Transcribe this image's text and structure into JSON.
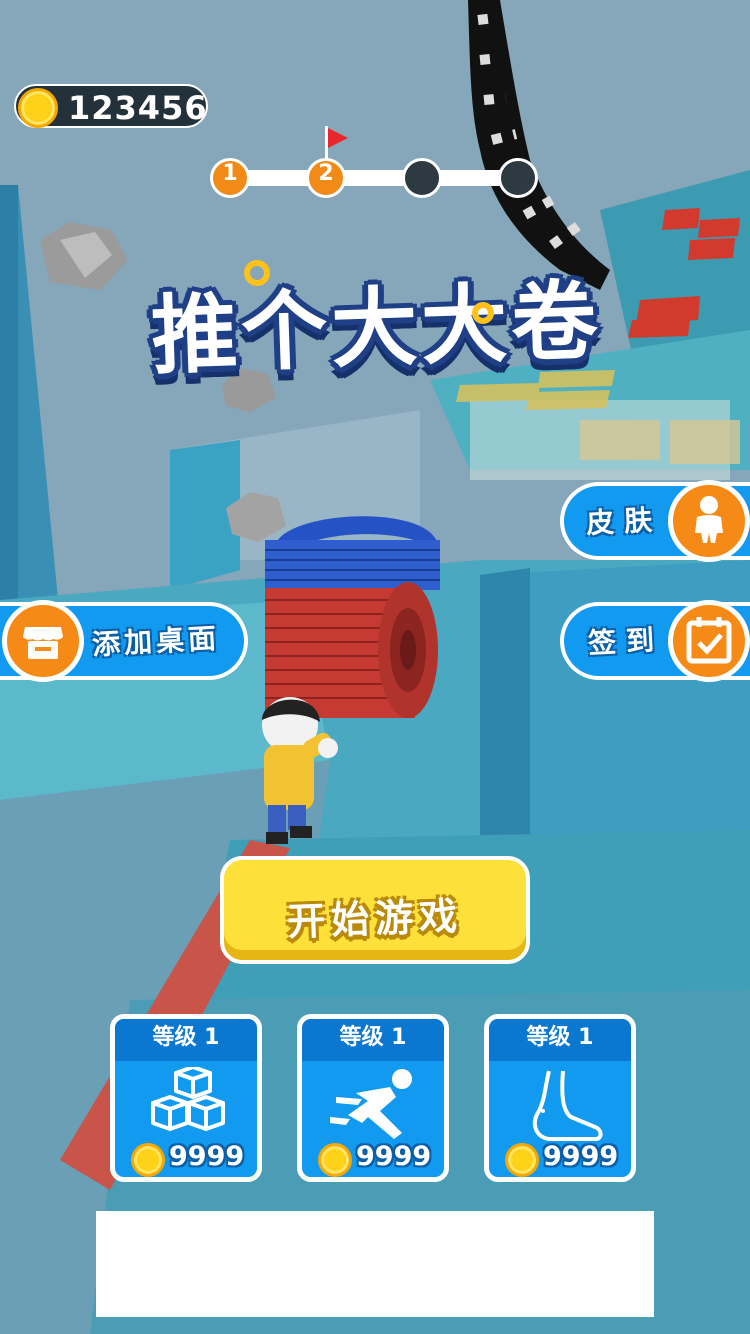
{
  "hud": {
    "coins": "123456"
  },
  "level_progress": {
    "nodes": [
      {
        "label": "1",
        "state": "done"
      },
      {
        "label": "2",
        "state": "done"
      },
      {
        "label": "",
        "state": "todo"
      },
      {
        "label": "",
        "state": "todo"
      }
    ],
    "current_index": 1,
    "flag_color": "#e8262b"
  },
  "title": {
    "text": "推个大大卷"
  },
  "buttons": {
    "skin": {
      "label": "皮肤",
      "icon": "person-icon"
    },
    "add_desktop": {
      "label": "添加桌面",
      "icon": "store-icon"
    },
    "signin": {
      "label": "签到",
      "icon": "calendar-check-icon"
    },
    "start": {
      "label": "开始游戏"
    }
  },
  "upgrades": [
    {
      "level_label": "等级 1",
      "price": "9999",
      "icon": "cubes-icon"
    },
    {
      "level_label": "等级 1",
      "price": "9999",
      "icon": "running-icon"
    },
    {
      "level_label": "等级 1",
      "price": "9999",
      "icon": "foot-icon"
    }
  ],
  "colors": {
    "accent_blue": "#129af0",
    "accent_orange": "#f58b16",
    "start_yellow": "#fde03a",
    "coin_gold": "#ffd21a"
  }
}
